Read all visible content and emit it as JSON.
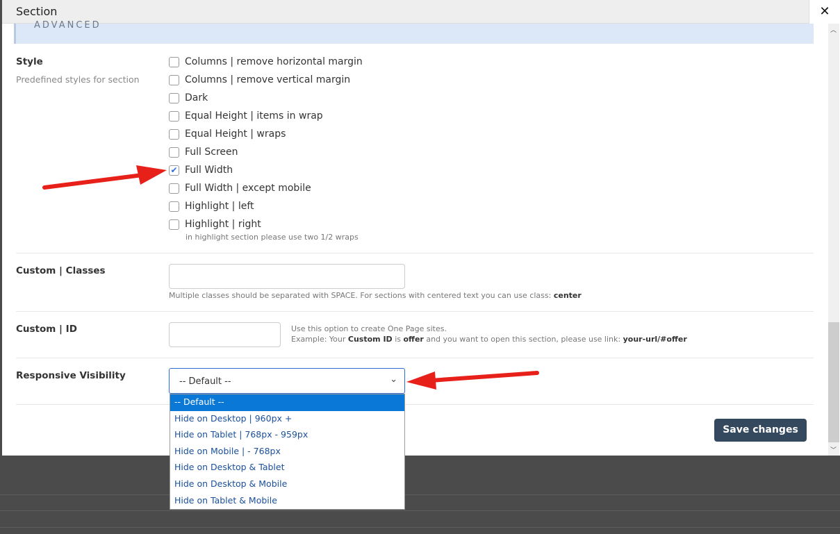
{
  "dialog": {
    "title": "Section",
    "close_icon": "close-icon",
    "banner": "ADVANCED"
  },
  "style": {
    "label": "Style",
    "sublabel": "Predefined styles for section",
    "options": [
      {
        "label": "Columns | remove horizontal margin",
        "checked": false
      },
      {
        "label": "Columns | remove vertical margin",
        "checked": false
      },
      {
        "label": "Dark",
        "checked": false
      },
      {
        "label": "Equal Height | items in wrap",
        "checked": false
      },
      {
        "label": "Equal Height | wraps",
        "checked": false
      },
      {
        "label": "Full Screen",
        "checked": false
      },
      {
        "label": "Full Width",
        "checked": true
      },
      {
        "label": "Full Width | except mobile",
        "checked": false
      },
      {
        "label": "Highlight | left",
        "checked": false
      },
      {
        "label": "Highlight | right",
        "checked": false
      }
    ],
    "note": "in highlight section please use two 1/2 wraps"
  },
  "classes": {
    "label": "Custom | Classes",
    "value": "",
    "hint": "Multiple classes should be separated with SPACE. For sections with centered text you can use class: ",
    "hint_bold": "center"
  },
  "custom_id": {
    "label": "Custom | ID",
    "value": "",
    "hint1": "Use this option to create One Page sites.",
    "hint2a": "Example: Your ",
    "hint2b": "Custom ID",
    "hint2c": " is ",
    "hint2d": "offer",
    "hint2e": " and you want to open this section, please use link: ",
    "hint2f": "your-url/#offer"
  },
  "visibility": {
    "label": "Responsive Visibility",
    "selected": "-- Default --",
    "options": [
      "-- Default --",
      "Hide on Desktop | 960px +",
      "Hide on Tablet | 768px - 959px",
      "Hide on Mobile | - 768px",
      "Hide on Desktop & Tablet",
      "Hide on Desktop & Mobile",
      "Hide on Tablet & Mobile"
    ]
  },
  "save_label": "Save changes",
  "colors": {
    "accent": "#0a78d7",
    "button": "#34495e",
    "arrow": "#e8201a"
  }
}
